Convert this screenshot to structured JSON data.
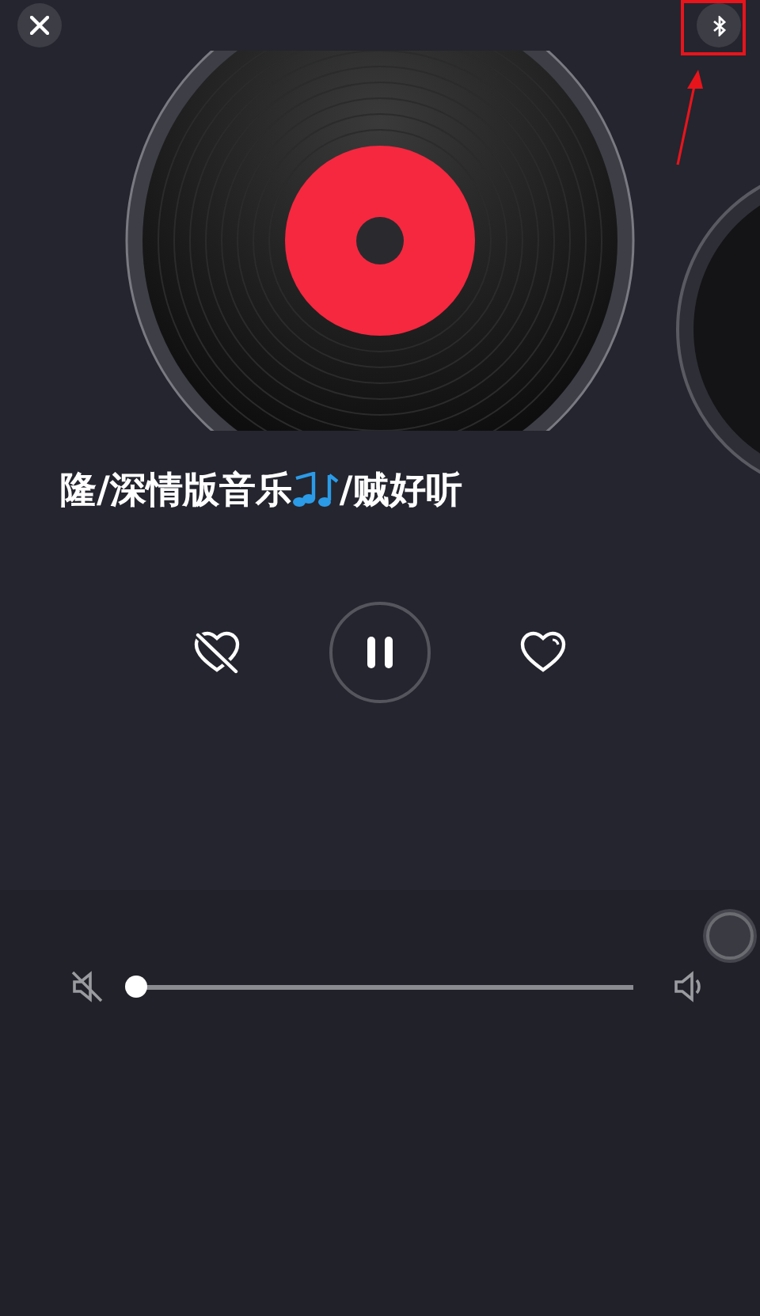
{
  "song": {
    "title_start": "隆/深情版音乐",
    "title_end": "/贼好听"
  },
  "playback": {
    "playing": true
  },
  "volume": {
    "level": 0
  }
}
